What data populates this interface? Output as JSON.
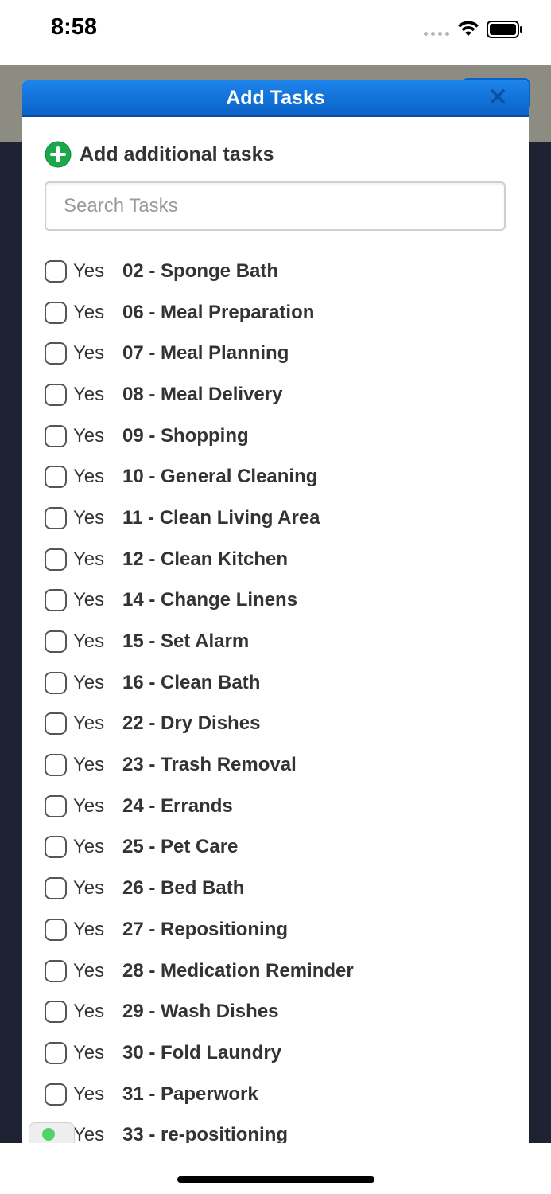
{
  "status_bar": {
    "time": "8:58"
  },
  "modal": {
    "title": "Add Tasks",
    "add_additional_label": "Add additional tasks",
    "search_placeholder": "Search Tasks",
    "yes_label": "Yes",
    "tasks": [
      {
        "name": "02 - Sponge Bath",
        "checked": false
      },
      {
        "name": "06 - Meal Preparation",
        "checked": false
      },
      {
        "name": "07 - Meal Planning",
        "checked": false
      },
      {
        "name": "08 - Meal Delivery",
        "checked": false
      },
      {
        "name": "09 - Shopping",
        "checked": false
      },
      {
        "name": "10 - General Cleaning",
        "checked": false
      },
      {
        "name": "11 - Clean Living Area",
        "checked": false
      },
      {
        "name": "12 - Clean Kitchen",
        "checked": false
      },
      {
        "name": "14 - Change Linens",
        "checked": false
      },
      {
        "name": "15 - Set Alarm",
        "checked": false
      },
      {
        "name": "16 - Clean Bath",
        "checked": false
      },
      {
        "name": "22 - Dry Dishes",
        "checked": false
      },
      {
        "name": "23 - Trash Removal",
        "checked": false
      },
      {
        "name": "24 - Errands",
        "checked": false
      },
      {
        "name": "25 - Pet Care",
        "checked": false
      },
      {
        "name": "26 - Bed Bath",
        "checked": false
      },
      {
        "name": "27 - Repositioning",
        "checked": false
      },
      {
        "name": "28 - Medication Reminder",
        "checked": false
      },
      {
        "name": "29 - Wash Dishes",
        "checked": false
      },
      {
        "name": "30 - Fold Laundry",
        "checked": false
      },
      {
        "name": "31 - Paperwork",
        "checked": false
      },
      {
        "name": "33 - re-positioning",
        "checked": false
      }
    ]
  },
  "colors": {
    "header_blue": "#0a62c8",
    "add_icon_green": "#1aa84a",
    "app_background": "#1d2333",
    "app_header_gray": "#8d8c83"
  }
}
